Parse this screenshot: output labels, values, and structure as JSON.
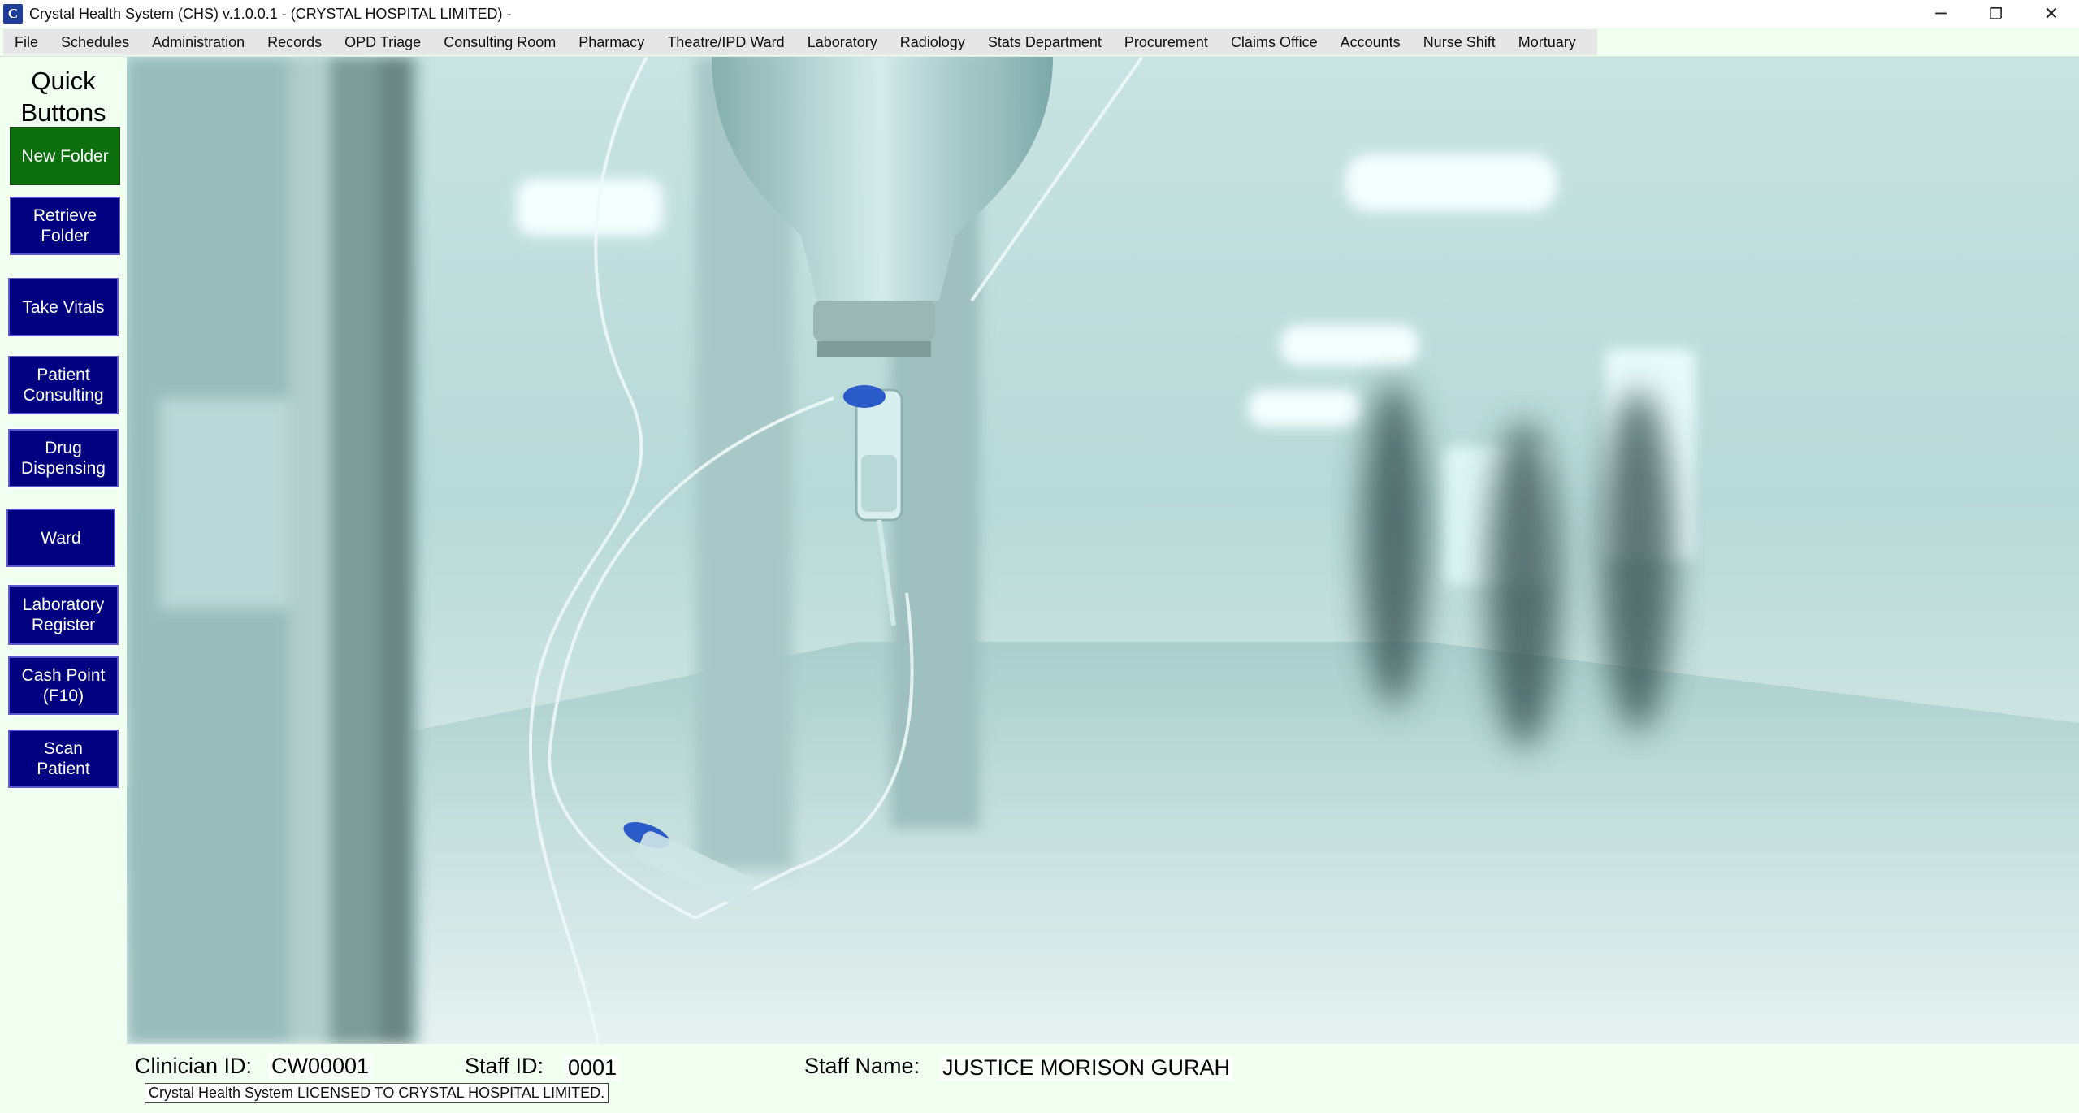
{
  "window": {
    "title": "Crystal Health System (CHS) v.1.0.0.1 - (CRYSTAL HOSPITAL LIMITED) -",
    "app_icon": "C",
    "controls": {
      "minimize": "─",
      "restore": "❐",
      "close": "✕"
    }
  },
  "menu": {
    "items": [
      "File",
      "Schedules",
      "Administration",
      "Records",
      "OPD Triage",
      "Consulting Room",
      "Pharmacy",
      "Theatre/IPD Ward",
      "Laboratory",
      "Radiology",
      "Stats Department",
      "Procurement",
      "Claims Office",
      "Accounts",
      "Nurse Shift",
      "Mortuary"
    ]
  },
  "sidebar": {
    "title": "Quick\nButtons",
    "buttons": [
      {
        "label": "New Folder"
      },
      {
        "label": "Retrieve\nFolder"
      },
      {
        "label": "Take Vitals"
      },
      {
        "label": "Patient\nConsulting"
      },
      {
        "label": "Drug\nDispensing"
      },
      {
        "label": "Ward"
      },
      {
        "label": "Laboratory\nRegister"
      },
      {
        "label": "Cash Point\n(F10)"
      },
      {
        "label": "Scan\nPatient"
      }
    ]
  },
  "status": {
    "clinician_label": "Clinician ID:",
    "clinician_id": "CW00001",
    "staff_label": "Staff ID:",
    "staff_id": "0001",
    "name_label": "Staff Name:",
    "staff_name": "JUSTICE MORISON GURAH",
    "license_text": "Crystal Health System LICENSED TO CRYSTAL HOSPITAL LIMITED."
  },
  "colors": {
    "quick_button": "#000080",
    "quick_button_active": "#0d6e0d",
    "background": "#f0fff0"
  }
}
